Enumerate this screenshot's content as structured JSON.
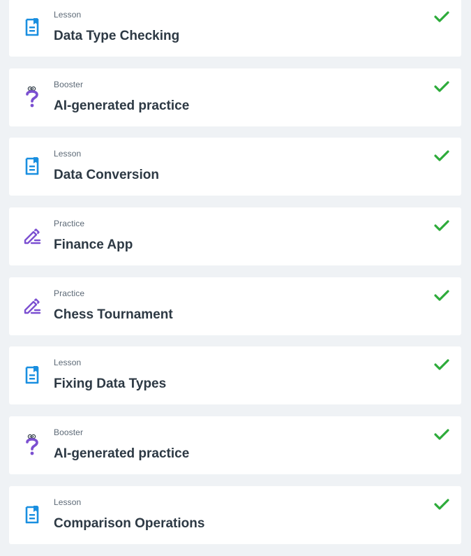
{
  "colors": {
    "background": "#eff2f5",
    "card": "#ffffff",
    "lesson_icon": "#1a8fe0",
    "practice_icon": "#7b4fd1",
    "booster_icon": "#7b4fd1",
    "check": "#2dab3a",
    "title_text": "#2d3944",
    "type_text": "#5b6875"
  },
  "items": [
    {
      "type": "Lesson",
      "title": "Data Type Checking",
      "icon": "lesson-document-icon",
      "completed": true
    },
    {
      "type": "Booster",
      "title": "AI-generated practice",
      "icon": "question-mark-icon",
      "completed": true
    },
    {
      "type": "Lesson",
      "title": "Data Conversion",
      "icon": "lesson-document-icon",
      "completed": true
    },
    {
      "type": "Practice",
      "title": "Finance App",
      "icon": "pencil-icon",
      "completed": true
    },
    {
      "type": "Practice",
      "title": "Chess Tournament",
      "icon": "pencil-icon",
      "completed": true
    },
    {
      "type": "Lesson",
      "title": "Fixing Data Types",
      "icon": "lesson-document-icon",
      "completed": true
    },
    {
      "type": "Booster",
      "title": "AI-generated practice",
      "icon": "question-mark-icon",
      "completed": true
    },
    {
      "type": "Lesson",
      "title": "Comparison Operations",
      "icon": "lesson-document-icon",
      "completed": true
    }
  ]
}
